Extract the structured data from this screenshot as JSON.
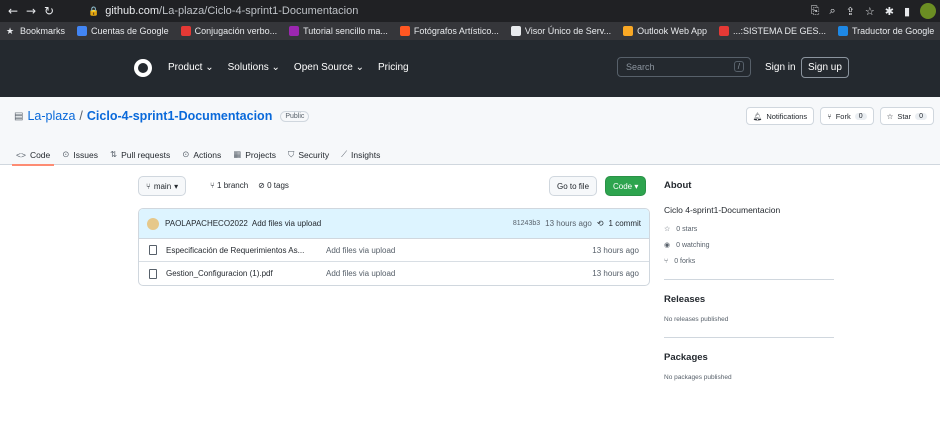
{
  "browser": {
    "url_host": "github.com",
    "url_path": "/La-plaza/Ciclo-4-sprint1-Documentacion",
    "bookmarks": [
      {
        "label": "Bookmarks",
        "color": "#e8eaed"
      },
      {
        "label": "Cuentas de Google",
        "color": "#4285f4"
      },
      {
        "label": "Conjugación verbo...",
        "color": "#e53935"
      },
      {
        "label": "Tutorial sencillo ma...",
        "color": "#9c27b0"
      },
      {
        "label": "Fotógrafos Artístico...",
        "color": "#ff5722"
      },
      {
        "label": "Visor Único de Serv...",
        "color": "#e8eaed"
      },
      {
        "label": "Outlook Web App",
        "color": "#f9a825"
      },
      {
        "label": "...:SISTEMA DE GES...",
        "color": "#e53935"
      },
      {
        "label": "Traductor de Google",
        "color": "#1e88e5"
      }
    ]
  },
  "gh_header": {
    "menu": [
      "Product ⌄",
      "Solutions ⌄",
      "Open Source ⌄",
      "Pricing"
    ],
    "search_placeholder": "Search",
    "slash": "/",
    "sign_in": "Sign in",
    "sign_up": "Sign up"
  },
  "repo": {
    "owner": "La-plaza",
    "sep": "/",
    "name": "Ciclo-4-sprint1-Documentacion",
    "visibility": "Public",
    "notifications": "Notifications",
    "fork": "Fork",
    "fork_count": "0",
    "star": "Star",
    "star_count": "0",
    "tabs": [
      {
        "label": "Code",
        "icon": "code-icon"
      },
      {
        "label": "Issues",
        "icon": "issue-icon"
      },
      {
        "label": "Pull requests",
        "icon": "pull-request-icon"
      },
      {
        "label": "Actions",
        "icon": "play-icon"
      },
      {
        "label": "Projects",
        "icon": "table-icon"
      },
      {
        "label": "Security",
        "icon": "shield-icon"
      },
      {
        "label": "Insights",
        "icon": "graph-icon"
      }
    ]
  },
  "code": {
    "branch": "main",
    "branches": "1 branch",
    "tags": "0 tags",
    "go_to_file": "Go to file",
    "code_btn": "Code ▾",
    "commit": {
      "author": "PAOLAPACHECO2022",
      "message": "Add files via upload",
      "hash": "81243b3",
      "time": "13 hours ago",
      "count": "1 commit"
    },
    "files": [
      {
        "name": "Especificación de Requerimientos As...",
        "message": "Add files via upload",
        "time": "13 hours ago"
      },
      {
        "name": "Gestion_Configuracion (1).pdf",
        "message": "Add files via upload",
        "time": "13 hours ago"
      }
    ]
  },
  "about": {
    "title": "About",
    "description": "Ciclo 4-sprint1-Documentacion",
    "stars": "0 stars",
    "watching": "0 watching",
    "forks": "0 forks",
    "releases_title": "Releases",
    "releases_text": "No releases published",
    "packages_title": "Packages",
    "packages_text": "No packages published"
  }
}
